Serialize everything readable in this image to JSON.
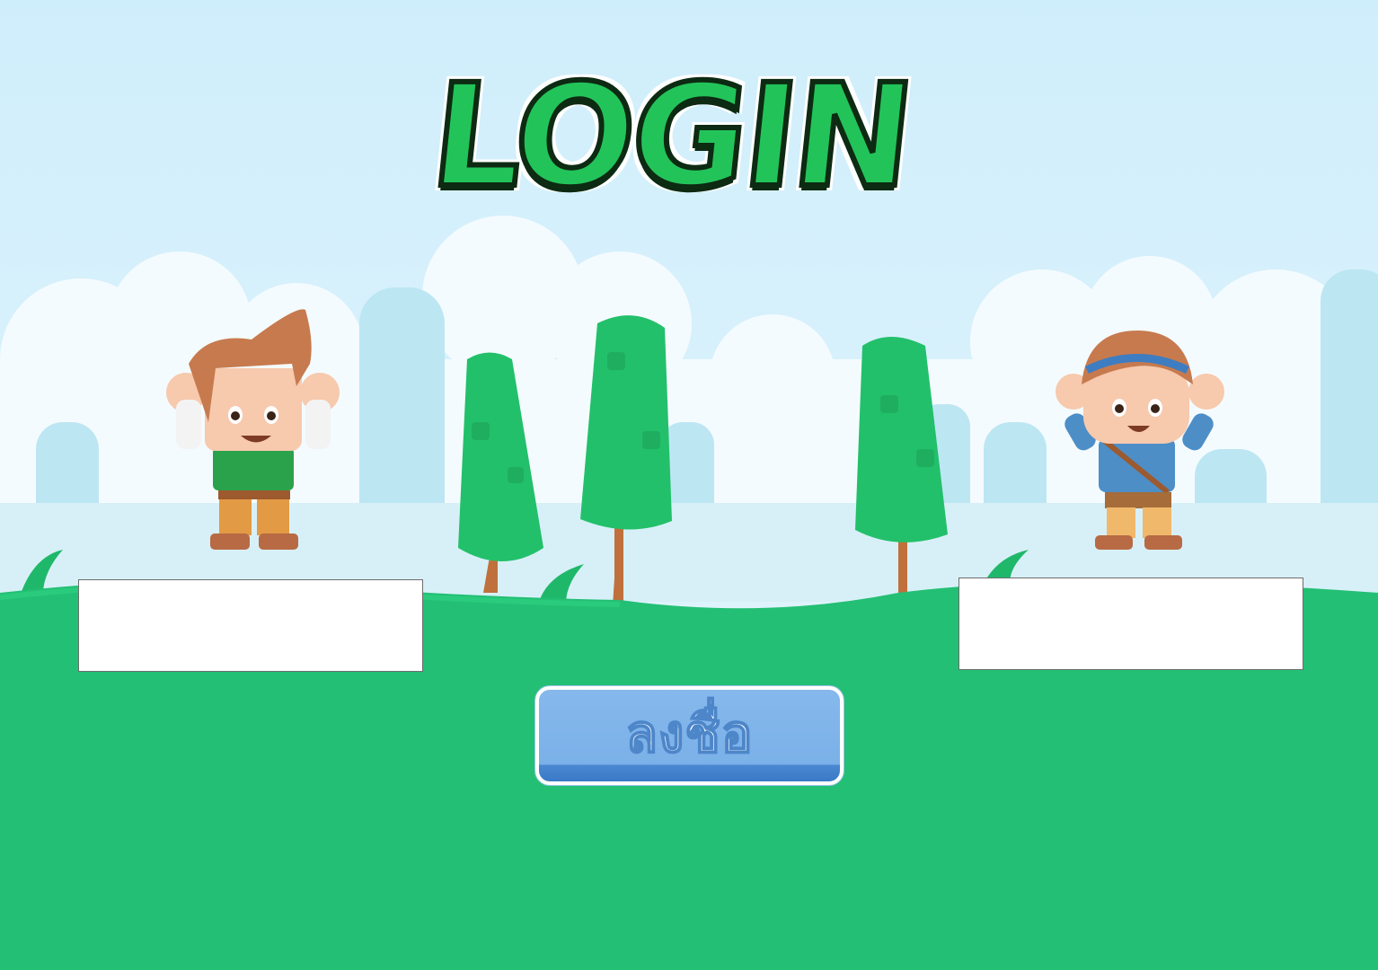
{
  "title": "LOGIN",
  "left_player": {
    "character": "boy-character",
    "name_value": ""
  },
  "right_player": {
    "character": "girl-character",
    "name_value": ""
  },
  "submit_button": {
    "label": "ลงชื่อ"
  },
  "colors": {
    "sky": "#cdeefb",
    "grass": "#23bf74",
    "tree": "#22c06a",
    "title_fill": "#22c45a",
    "button": "#7ab1e8"
  }
}
